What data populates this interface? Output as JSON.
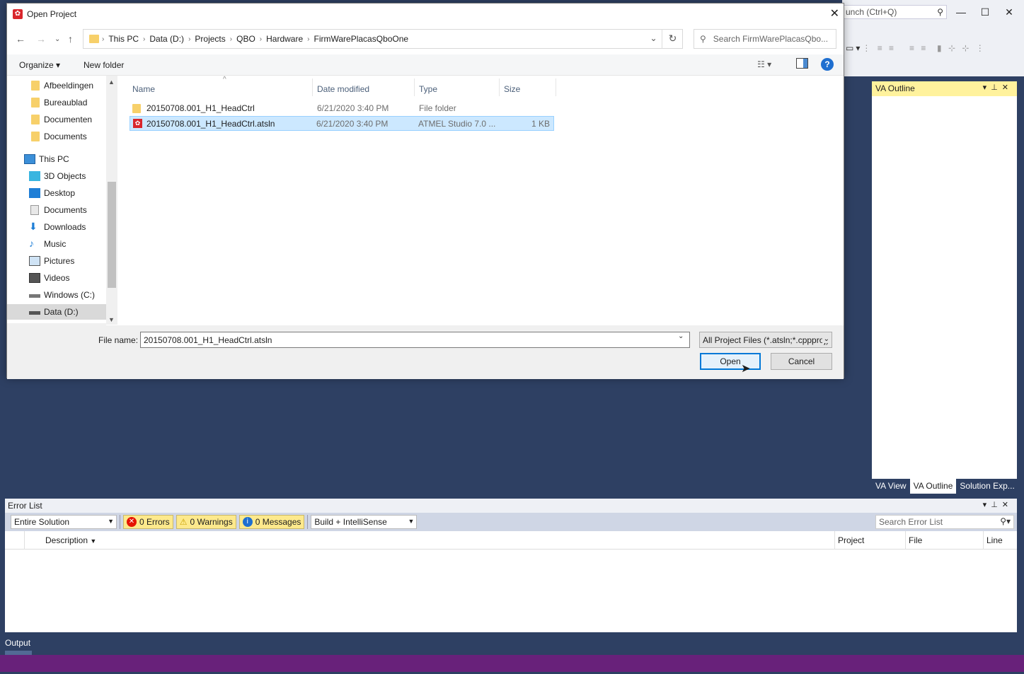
{
  "ide": {
    "quick_launch_placeholder": "unch (Ctrl+Q)",
    "minimize": "—",
    "maximize": "☐",
    "close": "✕",
    "va_outline": {
      "title": "VA Outline",
      "tabs": [
        "VA View",
        "VA Outline",
        "Solution Exp..."
      ]
    },
    "error_list": {
      "title": "Error List",
      "scope": "Entire Solution",
      "errors": "0 Errors",
      "warnings": "0 Warnings",
      "messages": "0 Messages",
      "filter": "Build + IntelliSense",
      "search_placeholder": "Search Error List",
      "columns": {
        "description": "Description",
        "project": "Project",
        "file": "File",
        "line": "Line"
      }
    },
    "output_tab": "Output",
    "colors": {
      "ide_bg": "#2e4063",
      "status_bar": "#68217a",
      "va_header": "#fff29d"
    }
  },
  "dialog": {
    "title": "Open Project",
    "breadcrumb": [
      "This PC",
      "Data (D:)",
      "Projects",
      "QBO",
      "Hardware",
      "FirmWarePlacasQboOne"
    ],
    "search_placeholder": "Search FirmWarePlacasQbo...",
    "commands": {
      "organize": "Organize ▾",
      "new_folder": "New folder"
    },
    "nav_items": [
      {
        "label": "Afbeeldingen",
        "icon": "folder-icon"
      },
      {
        "label": "Bureaublad",
        "icon": "folder-icon"
      },
      {
        "label": "Documenten",
        "icon": "folder-icon"
      },
      {
        "label": "Documents",
        "icon": "folder-icon"
      },
      {
        "label": "This PC",
        "icon": "computer-icon"
      },
      {
        "label": "3D Objects",
        "icon": "cube-icon"
      },
      {
        "label": "Desktop",
        "icon": "desktop-icon"
      },
      {
        "label": "Documents",
        "icon": "documents-icon"
      },
      {
        "label": "Downloads",
        "icon": "download-icon"
      },
      {
        "label": "Music",
        "icon": "music-icon"
      },
      {
        "label": "Pictures",
        "icon": "pictures-icon"
      },
      {
        "label": "Videos",
        "icon": "videos-icon"
      },
      {
        "label": "Windows (C:)",
        "icon": "drive-icon"
      },
      {
        "label": "Data (D:)",
        "icon": "drive-icon"
      }
    ],
    "columns": {
      "name": "Name",
      "date": "Date modified",
      "type": "Type",
      "size": "Size"
    },
    "files": [
      {
        "name": "20150708.001_H1_HeadCtrl",
        "date": "6/21/2020 3:40 PM",
        "type": "File folder",
        "size": ""
      },
      {
        "name": "20150708.001_H1_HeadCtrl.atsln",
        "date": "6/21/2020 3:40 PM",
        "type": "ATMEL Studio 7.0 ...",
        "size": "1 KB"
      }
    ],
    "file_name_label": "File name:",
    "file_name": "20150708.001_H1_HeadCtrl.atsln",
    "file_type": "All Project Files (*.atsln;*.cppproj)",
    "open_label": "Open",
    "cancel_label": "Cancel"
  }
}
